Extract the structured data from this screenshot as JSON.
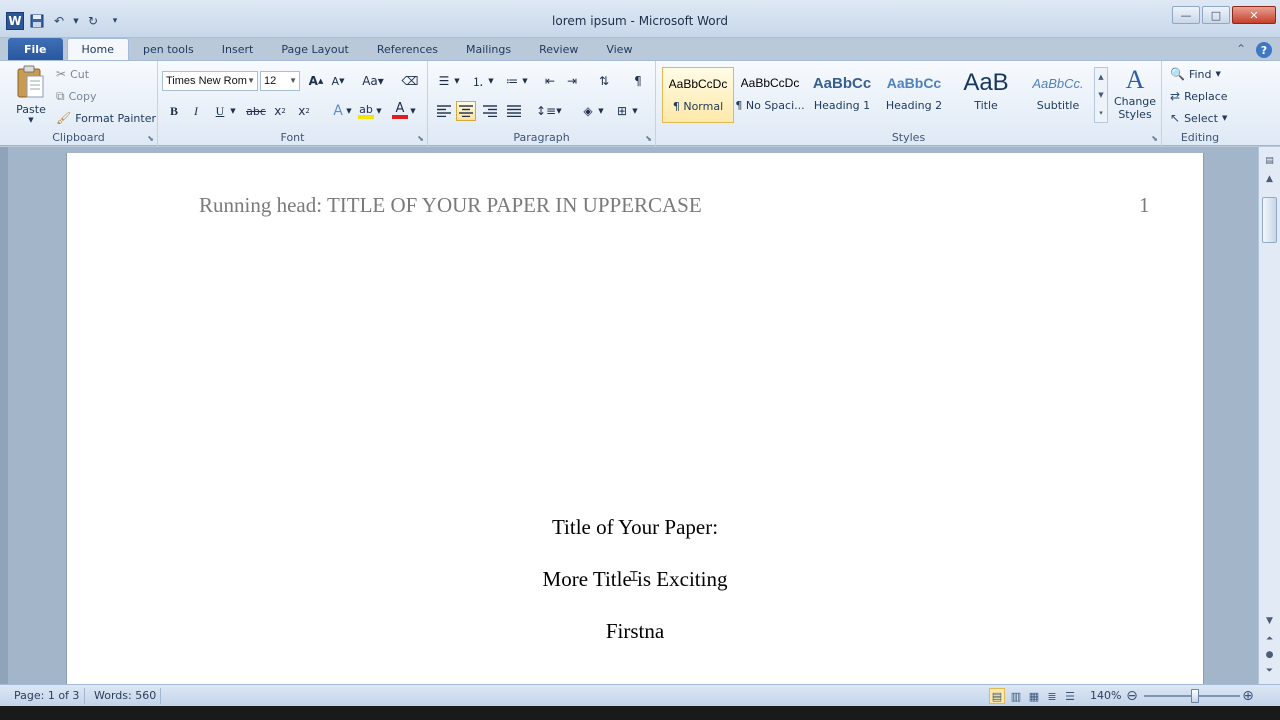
{
  "window": {
    "title": "lorem ipsum  -  Microsoft Word",
    "app_letter": "W"
  },
  "tabs": [
    "File",
    "Home",
    "pen tools",
    "Insert",
    "Page Layout",
    "References",
    "Mailings",
    "Review",
    "View"
  ],
  "active_tab": "Home",
  "ribbon": {
    "clipboard": {
      "label": "Clipboard",
      "paste": "Paste",
      "cut": "Cut",
      "copy": "Copy",
      "format_painter": "Format Painter"
    },
    "font": {
      "label": "Font",
      "font_name": "Times New Rom",
      "font_size": "12"
    },
    "paragraph": {
      "label": "Paragraph"
    },
    "styles": {
      "label": "Styles",
      "items": [
        {
          "sample": "AaBbCcDc",
          "name": "¶ Normal"
        },
        {
          "sample": "AaBbCcDc",
          "name": "¶ No Spaci..."
        },
        {
          "sample": "AaBbCc",
          "name": "Heading 1"
        },
        {
          "sample": "AaBbCc",
          "name": "Heading 2"
        },
        {
          "sample": "AaB",
          "name": "Title"
        },
        {
          "sample": "AaBbCc.",
          "name": "Subtitle"
        }
      ],
      "change_styles_line1": "Change",
      "change_styles_line2": "Styles"
    },
    "editing": {
      "label": "Editing",
      "find": "Find",
      "replace": "Replace",
      "select": "Select"
    }
  },
  "document": {
    "running_head": "Running head: TITLE OF YOUR PAPER IN UPPERCASE",
    "page_number": "1",
    "title_line1": "Title of Your Paper:",
    "title_line2": "More Title is Exciting",
    "author": "Firstna"
  },
  "status": {
    "page": "Page: 1 of 3",
    "words": "Words: 560",
    "zoom": "140%",
    "zoom_level_percent": 140
  },
  "colors": {
    "file_tab": "#2a57a0",
    "selected_style": "#fde9a9",
    "font_color_underline": "#e02020",
    "highlight_color": "#f5e400"
  }
}
